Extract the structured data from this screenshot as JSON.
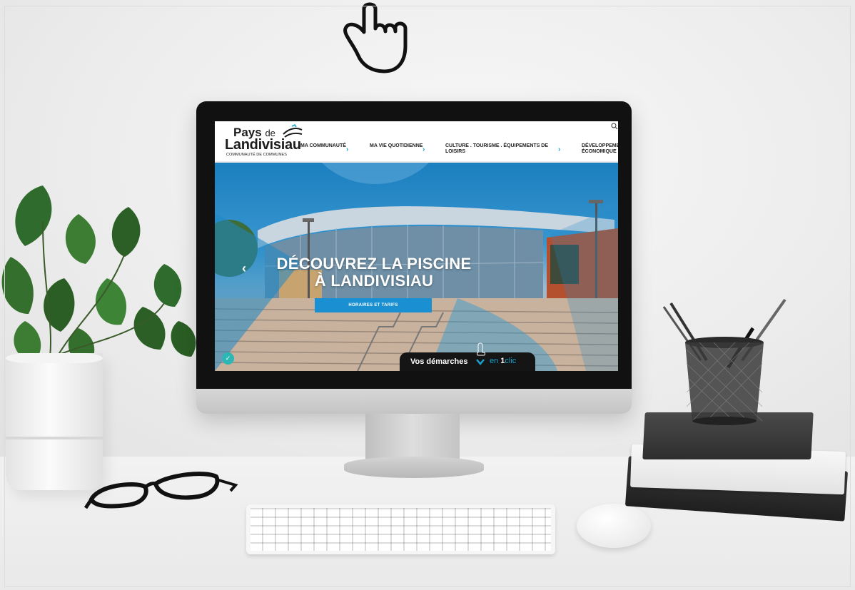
{
  "site": {
    "logo": {
      "line1": "Pays",
      "line1_de": "de",
      "line2": "Landivisiau",
      "tagline": "COMMUNAUTÉ DE COMMUNES"
    },
    "nav": [
      {
        "label": "MA COMMUNAUTÉ"
      },
      {
        "label": "MA VIE QUOTIDIENNE"
      },
      {
        "label": "CULTURE . TOURISME . ÉQUIPEMENTS DE LOISIRS"
      },
      {
        "label": "DÉVELOPPEMENT ÉCONOMIQUE"
      }
    ],
    "hero": {
      "title_line1": "DÉCOUVREZ LA PISCINE",
      "title_line2": "À LANDIVISIAU",
      "button_label": "HORAIRES ET TARIFS",
      "prev_icon": "chevron-left-icon"
    },
    "demarches": {
      "label": "Vos démarches",
      "brand_en": "en ",
      "brand_1": "1",
      "brand_clic": "clic"
    }
  },
  "colors": {
    "accent": "#1a8fd2",
    "nav_chevron": "#1aa0cc",
    "badge": "#2cb6b4",
    "monitor": "#111111"
  },
  "icons": [
    "hand-pointer-icon",
    "search-icon",
    "chevron-right-icon",
    "chevron-left-icon",
    "check-icon",
    "finger-tap-icon",
    "chevron-down-icon"
  ]
}
